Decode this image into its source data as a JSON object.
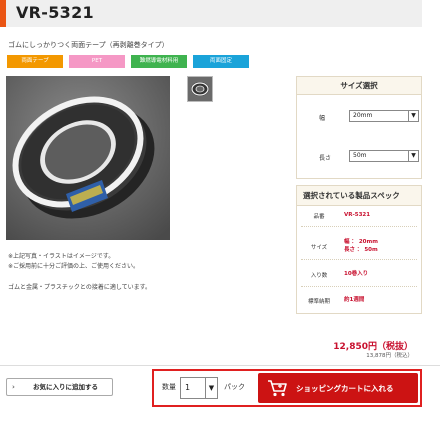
{
  "product": {
    "title": "VR-5321",
    "subtitle": "ゴムにしっかりつく両面テープ（再剥離巻タイプ）"
  },
  "tags": [
    {
      "label": "両面テープ",
      "color": "#f39800"
    },
    {
      "label": "PET",
      "color": "#f598c5"
    },
    {
      "label": "難燃導電材料用",
      "color": "#3fb34f"
    },
    {
      "label": "両面固定",
      "color": "#1aa3d9"
    }
  ],
  "notes": [
    "※上記写真・イラストはイメージです。",
    "※ご採用前に十分ご評価の上、ご使用ください。"
  ],
  "description": "ゴムと金属・プラスチックとの接着に適しています。",
  "size_panel": {
    "title": "サイズ選択",
    "width_label": "幅",
    "width_value": "20mm",
    "length_label": "長さ",
    "length_value": "50m"
  },
  "spec_panel": {
    "title": "選択されている製品スペック",
    "rows": [
      {
        "key": "品番",
        "value": "VR-5321"
      },
      {
        "key": "サイズ",
        "value_1": "幅 ： 20mm",
        "value_2": "長さ ： 50m"
      },
      {
        "key": "入り数",
        "value": "10巻入り"
      },
      {
        "key": "標準納期",
        "value": "約1週間"
      }
    ]
  },
  "price": {
    "main": "12,850円（税抜）",
    "tax": "13,878円（税込）"
  },
  "favorite": {
    "label": "お気に入りに追加する"
  },
  "cart": {
    "qty_label": "数量",
    "qty_value": "1",
    "unit_label": "パック",
    "button_label": "ショッピングカートに入れる"
  },
  "colors": {
    "accent": "#ea5514",
    "cart_red": "#cc1313",
    "spec_red": "#c8102e",
    "highlight_border": "#e02020"
  },
  "icons": {
    "favorite": "chevron-right-icon",
    "cart": "shopping-cart-icon",
    "select": "chevron-down-icon"
  }
}
